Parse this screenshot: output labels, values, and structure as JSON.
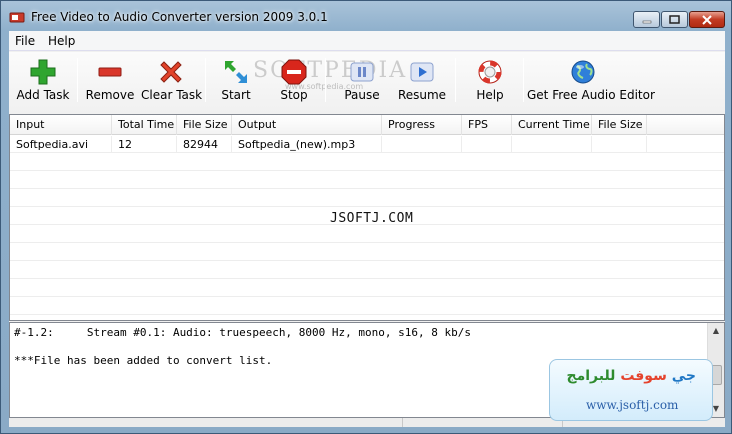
{
  "window": {
    "title": "Free Video to Audio Converter version 2009  3.0.1"
  },
  "menu": [
    "File",
    "Help"
  ],
  "toolbar": {
    "add_task": "Add Task",
    "remove": "Remove",
    "clear_task": "Clear Task",
    "start": "Start",
    "stop": "Stop",
    "pause": "Pause",
    "resume": "Resume",
    "help": "Help",
    "get_editor": "Get Free Audio Editor",
    "watermark": "SOFTPEDIA",
    "watermark_sub": "www.softpedia.com"
  },
  "grid": {
    "columns": [
      "Input",
      "Total Time",
      "File Size",
      "Output",
      "Progress",
      "FPS",
      "Current Time",
      "File Size"
    ],
    "rows": [
      [
        "Softpedia.avi",
        "12",
        "82944",
        "Softpedia_(new).mp3",
        "",
        "",
        "",
        ""
      ]
    ],
    "overlay_text": "JSOFTJ.COM"
  },
  "log": {
    "lines": [
      "#-1.2:     Stream #0.1: Audio: truespeech, 8000 Hz, mono, s16, 8 kb/s",
      "",
      "***File has been added to convert list."
    ]
  },
  "badge": {
    "arabic_1": "جي",
    "arabic_2": "سوفت",
    "arabic_3": "للبرامج",
    "url": "www.jsoftj.com"
  },
  "colors": {
    "add_green": "#2fa52f",
    "remove_red": "#d9362b",
    "stop_red": "#d8261c",
    "pause_blue": "#6b87c9",
    "accent_blue": "#1f77c5"
  }
}
